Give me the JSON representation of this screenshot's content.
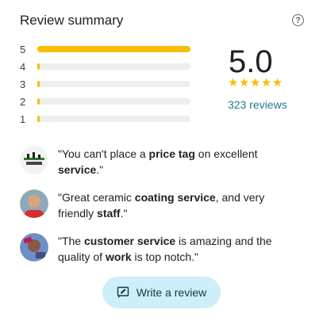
{
  "header": {
    "title": "Review summary",
    "help_icon": "help-circle-icon"
  },
  "rating_bars": [
    {
      "label": "5",
      "fraction": 1.0
    },
    {
      "label": "4",
      "fraction": 0.01
    },
    {
      "label": "3",
      "fraction": 0.01
    },
    {
      "label": "2",
      "fraction": 0.01
    },
    {
      "label": "1",
      "fraction": 0.01
    }
  ],
  "score": {
    "value": "5.0",
    "stars": "★★★★★",
    "reviews_link": "323 reviews"
  },
  "snippets": [
    {
      "parts": [
        {
          "t": "\"You can't place a ",
          "b": false
        },
        {
          "t": "price tag",
          "b": true
        },
        {
          "t": " on excellent ",
          "b": false
        },
        {
          "t": "service",
          "b": true
        },
        {
          "t": ".\"",
          "b": false
        }
      ]
    },
    {
      "parts": [
        {
          "t": "\"Great ceramic ",
          "b": false
        },
        {
          "t": "coating service",
          "b": true
        },
        {
          "t": ", and very friendly ",
          "b": false
        },
        {
          "t": "staff",
          "b": true
        },
        {
          "t": ".\"",
          "b": false
        }
      ]
    },
    {
      "parts": [
        {
          "t": "\"The ",
          "b": false
        },
        {
          "t": "customer service",
          "b": true
        },
        {
          "t": " is amazing and the quality of ",
          "b": false
        },
        {
          "t": "work",
          "b": true
        },
        {
          "t": " is top notch.\"",
          "b": false
        }
      ]
    }
  ],
  "write_review": {
    "label": "Write a review",
    "icon": "rate-review-icon"
  },
  "colors": {
    "star": "#fbbc04",
    "track": "#eeeeee",
    "button_bg": "#cdeff7",
    "link": "#1f7a8c"
  }
}
